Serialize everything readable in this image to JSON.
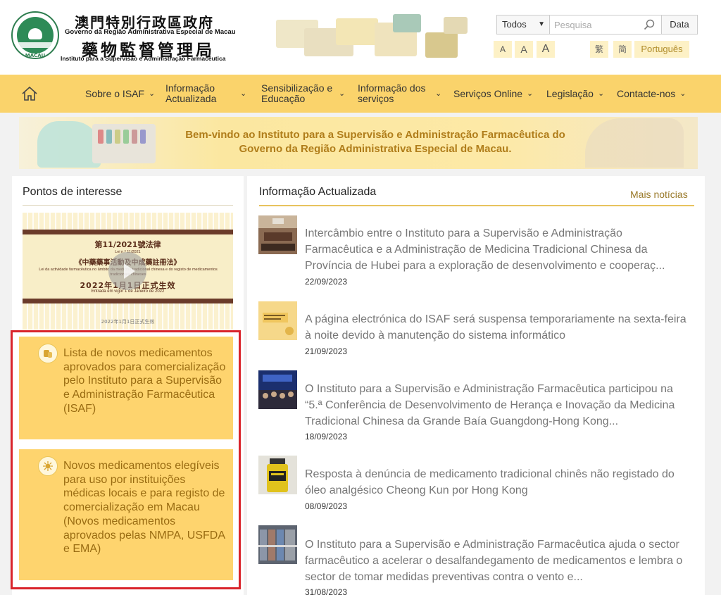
{
  "header": {
    "gov_zh": "澳門特別行政區政府",
    "gov_pt": "Governo da Região Administrativa Especial de Macau",
    "inst_zh": "藥物監督管理局",
    "inst_pt": "Instituto para a Supervisão e Administração Farmacêutica",
    "emblem_label": "MACAU"
  },
  "search": {
    "category": "Todos",
    "placeholder": "Pesquisa",
    "data_button": "Data"
  },
  "font_sizes": [
    "A",
    "A",
    "A"
  ],
  "languages": [
    "繁",
    "简",
    "Português"
  ],
  "nav": {
    "items": [
      {
        "label": "Sobre o ISAF"
      },
      {
        "label": "Informação Actualizada"
      },
      {
        "label": "Sensibilização e Educação"
      },
      {
        "label": "Informação dos serviços"
      },
      {
        "label": "Serviços Online"
      },
      {
        "label": "Legislação"
      },
      {
        "label": "Contacte-nos"
      }
    ]
  },
  "welcome": {
    "line1": "Bem-vindo ao Instituto para a Supervisão e Administração Farmacêutica do",
    "line2": "Governo da Região Administrativa Especial de Macau."
  },
  "points": {
    "title": "Pontos de interesse",
    "law_card": {
      "title": "第11/2021號法律",
      "sub": "Lei n.º 11/2021",
      "name": "《中藥藥事活動及中成藥註冊法》",
      "desc": "Lei da actividade farmacêutica no âmbito da medicina tradicional chinesa e do registo de medicamentos tradicionais chineses",
      "effective": "2022年1月1日正式生效",
      "effective_pt": "Entrada em vigor 1 de Janeiro de 2022",
      "caption": "2022年1月1日正式生效"
    },
    "tiles": [
      {
        "text": "Lista de novos medicamentos aprovados para comercialização pelo Instituto para a Supervisão e Administração Farmacêutica (ISAF)",
        "icon": "pills-icon"
      },
      {
        "text": "Novos medicamentos elegíveis para uso por instituições médicas locais e para registo de comercialização em Macau (Novos medicamentos aprovados pelas NMPA, USFDA e EMA)",
        "icon": "virus-icon"
      }
    ]
  },
  "news": {
    "title": "Informação Actualizada",
    "more": "Mais notícias",
    "items": [
      {
        "title": "Intercâmbio entre o Instituto para a Supervisão e Administração Farmacêutica e a Administração de Medicina Tradicional Chinesa da Província de Hubei para a exploração de desenvolvimento e cooperaç...",
        "date": "22/09/2023"
      },
      {
        "title": "A página electrónica do ISAF será suspensa temporariamente na sexta-feira à noite devido à manutenção do sistema informático",
        "date": "21/09/2023"
      },
      {
        "title": "O Instituto para a Supervisão e Administração Farmacêutica participou na “5.ª Conferência de Desenvolvimento de Herança e Inovação da Medicina Tradicional Chinesa da Grande Baía Guangdong-Hong Kong...",
        "date": "18/09/2023"
      },
      {
        "title": "Resposta à denúncia de medicamento tradicional chinês não registado do óleo analgésico Cheong Kun por Hong Kong",
        "date": "08/09/2023"
      },
      {
        "title": "O Instituto para a Supervisão e Administração Farmacêutica ajuda o sector farmacêutico a acelerar o desalfandegamento de medicamentos e lembra o sector de tomar medidas preventivas contra o vento e...",
        "date": "31/08/2023"
      }
    ]
  },
  "colors": {
    "nav_bg": "#fad36b",
    "tile_bg": "#fed46e",
    "highlight_border": "#d9242b",
    "accent_text": "#9a6c12"
  }
}
